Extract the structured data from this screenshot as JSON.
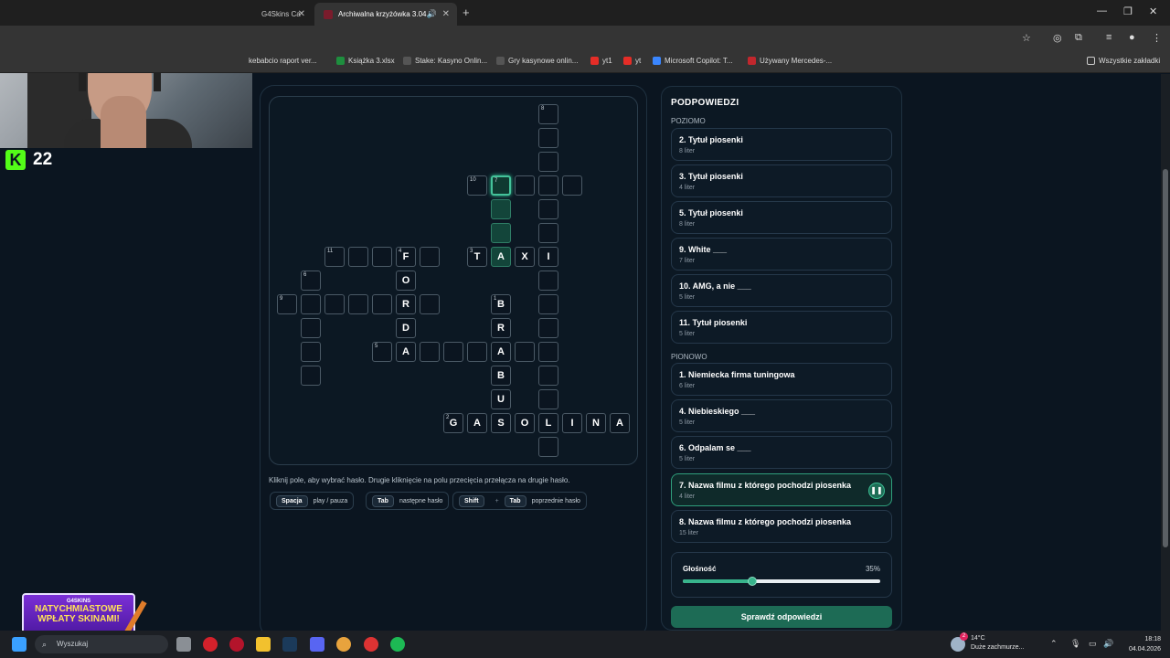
{
  "browser": {
    "tabs": [
      {
        "label": "G4Skins Ca"
      },
      {
        "label": "Archiwalna krzyżówka 3.04."
      }
    ],
    "bookmarks": [
      "kebabcio raport ver...",
      "Książka 3.xlsx",
      "Stake: Kasyno Onlin...",
      "Gry kasynowe onlin...",
      "yt1",
      "yt",
      "Microsoft Copilot: T...",
      "Używany Mercedes-...",
      "Wszystkie zakładki"
    ]
  },
  "stream": {
    "viewer_count": "22"
  },
  "crossword": {
    "cells": [
      {
        "r": 0,
        "c": 11,
        "n": "8"
      },
      {
        "r": 1,
        "c": 11
      },
      {
        "r": 2,
        "c": 11
      },
      {
        "r": 3,
        "c": 8,
        "n": "10"
      },
      {
        "r": 3,
        "c": 9,
        "n": "7",
        "state": "sel"
      },
      {
        "r": 3,
        "c": 10
      },
      {
        "r": 3,
        "c": 11
      },
      {
        "r": 3,
        "c": 12
      },
      {
        "r": 4,
        "c": 9,
        "state": "hl"
      },
      {
        "r": 4,
        "c": 11
      },
      {
        "r": 5,
        "c": 9,
        "state": "hl"
      },
      {
        "r": 5,
        "c": 11
      },
      {
        "r": 6,
        "c": 2,
        "n": "11"
      },
      {
        "r": 6,
        "c": 3
      },
      {
        "r": 6,
        "c": 4
      },
      {
        "r": 6,
        "c": 5,
        "n": "4",
        "l": "F"
      },
      {
        "r": 6,
        "c": 6
      },
      {
        "r": 6,
        "c": 8,
        "n": "3",
        "l": "T"
      },
      {
        "r": 6,
        "c": 9,
        "l": "A",
        "state": "hl"
      },
      {
        "r": 6,
        "c": 10,
        "l": "X"
      },
      {
        "r": 6,
        "c": 11,
        "l": "I"
      },
      {
        "r": 7,
        "c": 1,
        "n": "6"
      },
      {
        "r": 7,
        "c": 5,
        "l": "O"
      },
      {
        "r": 7,
        "c": 11
      },
      {
        "r": 8,
        "c": 0,
        "n": "9"
      },
      {
        "r": 8,
        "c": 1
      },
      {
        "r": 8,
        "c": 2
      },
      {
        "r": 8,
        "c": 3
      },
      {
        "r": 8,
        "c": 4
      },
      {
        "r": 8,
        "c": 5,
        "l": "R"
      },
      {
        "r": 8,
        "c": 6
      },
      {
        "r": 8,
        "c": 9,
        "n": "1",
        "l": "B"
      },
      {
        "r": 8,
        "c": 11
      },
      {
        "r": 9,
        "c": 1
      },
      {
        "r": 9,
        "c": 5,
        "l": "D"
      },
      {
        "r": 9,
        "c": 9,
        "l": "R"
      },
      {
        "r": 9,
        "c": 11
      },
      {
        "r": 10,
        "c": 1
      },
      {
        "r": 10,
        "c": 4,
        "n": "5"
      },
      {
        "r": 10,
        "c": 5,
        "l": "A"
      },
      {
        "r": 10,
        "c": 6
      },
      {
        "r": 10,
        "c": 7
      },
      {
        "r": 10,
        "c": 8
      },
      {
        "r": 10,
        "c": 9,
        "l": "A"
      },
      {
        "r": 10,
        "c": 10
      },
      {
        "r": 10,
        "c": 11
      },
      {
        "r": 11,
        "c": 1
      },
      {
        "r": 11,
        "c": 9,
        "l": "B"
      },
      {
        "r": 11,
        "c": 11
      },
      {
        "r": 12,
        "c": 9,
        "l": "U"
      },
      {
        "r": 12,
        "c": 11
      },
      {
        "r": 13,
        "c": 7,
        "n": "2",
        "l": "G"
      },
      {
        "r": 13,
        "c": 8,
        "l": "A"
      },
      {
        "r": 13,
        "c": 9,
        "l": "S"
      },
      {
        "r": 13,
        "c": 10,
        "l": "O"
      },
      {
        "r": 13,
        "c": 11,
        "l": "L"
      },
      {
        "r": 13,
        "c": 12,
        "l": "I"
      },
      {
        "r": 13,
        "c": 13,
        "l": "N"
      },
      {
        "r": 13,
        "c": 14,
        "l": "A"
      },
      {
        "r": 14,
        "c": 11
      }
    ],
    "hint": "Kliknij pole, aby wybrać hasło. Drugie kliknięcie na polu przecięcia przełącza na drugie hasło.",
    "shortcuts": {
      "k1": "Spacja",
      "d1": "play / pauza",
      "k2": "Tab",
      "d2": "następne hasło",
      "k3a": "Shift",
      "plus": "+",
      "k3b": "Tab",
      "d3": "poprzednie hasło"
    }
  },
  "clues": {
    "title": "PODPOWIEDZI",
    "across_label": "POZIOMO",
    "across": [
      {
        "title": "2. Tytuł piosenki",
        "sub": "8 liter"
      },
      {
        "title": "3. Tytuł piosenki",
        "sub": "4 liter"
      },
      {
        "title": "5. Tytuł piosenki",
        "sub": "8 liter"
      },
      {
        "title": "9. White ___",
        "sub": "7 liter"
      },
      {
        "title": "10. AMG, a nie ___",
        "sub": "5 liter"
      },
      {
        "title": "11. Tytuł piosenki",
        "sub": "5 liter"
      }
    ],
    "down_label": "PIONOWO",
    "down": [
      {
        "title": "1. Niemiecka firma tuningowa",
        "sub": "6 liter"
      },
      {
        "title": "4. Niebieskiego ___",
        "sub": "5 liter"
      },
      {
        "title": "6. Odpalam se ___",
        "sub": "5 liter"
      },
      {
        "title": "7. Nazwa filmu z którego pochodzi piosenka",
        "sub": "4 liter"
      },
      {
        "title": "8. Nazwa filmu z którego pochodzi piosenka",
        "sub": "15 liter"
      }
    ],
    "volume": {
      "label": "Głośność",
      "value_text": "35%",
      "value": 0.35
    },
    "check_button": "Sprawdź odpowiedzi"
  },
  "promo": {
    "brand": "G4SKINS",
    "line1": "NATYCHMIASTOWE",
    "line2": "WPŁATY SKINAMI!"
  },
  "taskbar": {
    "search_placeholder": "Wyszukaj",
    "weather_temp": "14°C",
    "weather_desc": "Duże zachmurze...",
    "time": "18:18",
    "date": "04.04.2026",
    "weather_badge": "2"
  }
}
